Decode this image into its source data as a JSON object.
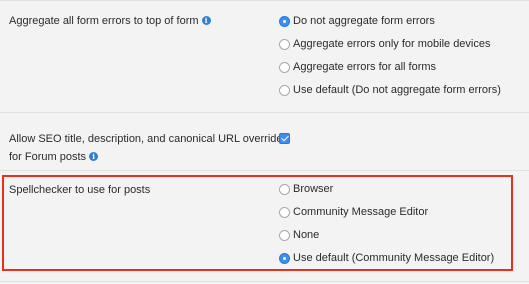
{
  "aggregate": {
    "label": "Aggregate all form errors to top of form",
    "options": [
      {
        "label": "Do not aggregate form errors",
        "selected": true
      },
      {
        "label": "Aggregate errors only for mobile devices",
        "selected": false
      },
      {
        "label": "Aggregate errors for all forms",
        "selected": false
      },
      {
        "label": "Use default (Do not aggregate form errors)",
        "selected": false
      }
    ]
  },
  "seo": {
    "label_line1": "Allow SEO title, description, and canonical URL overrides",
    "label_line2": "for Forum posts",
    "checked": true
  },
  "spellchecker": {
    "label": "Spellchecker to use for posts",
    "options": [
      {
        "label": "Browser",
        "selected": false
      },
      {
        "label": "Community Message Editor",
        "selected": false
      },
      {
        "label": "None",
        "selected": false
      },
      {
        "label": "Use default (Community Message Editor)",
        "selected": true
      }
    ]
  },
  "colors": {
    "accent": "#3a8ef0",
    "highlight_border": "#e8301e"
  },
  "icons": {
    "info": "info-icon"
  }
}
